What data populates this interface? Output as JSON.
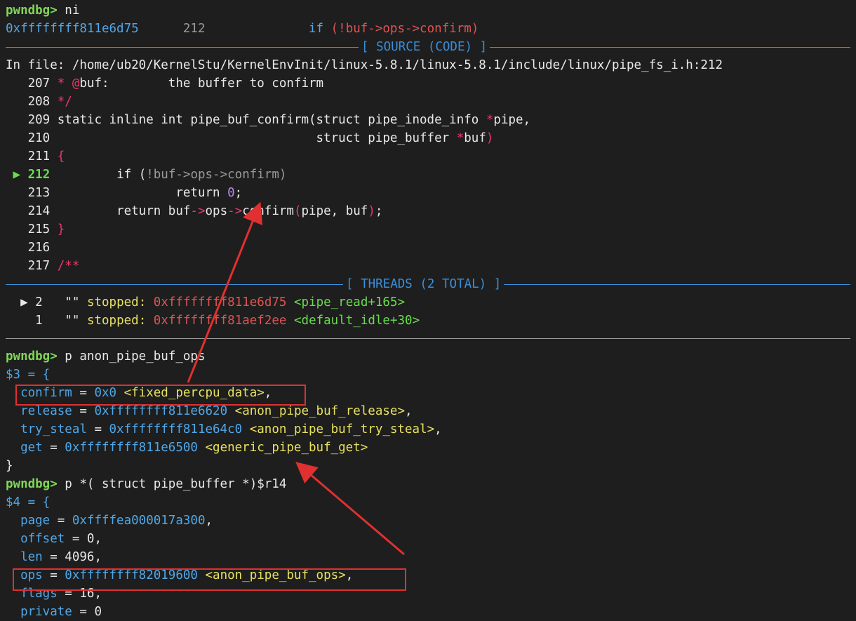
{
  "prompt": "pwndbg>",
  "cmd1": " ni",
  "pc_line": {
    "addr": "0xffffffff811e6d75",
    "lineno": "212",
    "code_if": "if",
    "code_rest": "(!buf->ops->confirm)"
  },
  "source_header": "[ SOURCE (CODE) ]",
  "in_file": "In file: /home/ub20/KernelStu/KernelEnvInit/linux-5.8.1/linux-5.8.1/include/linux/pipe_fs_i.h:212",
  "source": {
    "l207": {
      "no": "207",
      "a": " * ",
      "b": "@",
      "c": "buf:        the buffer to confirm"
    },
    "l208": {
      "no": "208",
      "a": " */"
    },
    "l209": {
      "no": "209",
      "a": "static inline int pipe_buf_confirm(struct pipe_inode_info ",
      "b": "*",
      "c": "pipe,"
    },
    "l210": {
      "no": "210",
      "a": "                                   struct pipe_buffer ",
      "b": "*",
      "c": "buf",
      "d": ")"
    },
    "l211": {
      "no": "211",
      "a": "{"
    },
    "l212": {
      "marker": "▶",
      "no": "212",
      "a": "        if (",
      "b": "!buf->ops->confirm)"
    },
    "l213": {
      "no": "213",
      "a": "                return ",
      "b": "0",
      "c": ";"
    },
    "l214": {
      "no": "214",
      "a": "        return buf",
      "b": "->",
      "c": "ops",
      "d": "->",
      "e": "confirm",
      "f": "(",
      "g": "pipe, buf",
      "h": ")",
      "i": ";"
    },
    "l215": {
      "no": "215",
      "a": "}"
    },
    "l216": {
      "no": "216"
    },
    "l217": {
      "no": "217",
      "a": "/**"
    }
  },
  "threads_header": "[ THREADS (2 TOTAL) ]",
  "threads": [
    {
      "marker": "▶",
      "id": "2",
      "name": "\"\"",
      "state": "stopped:",
      "addr": "0xffffffff811e6d75",
      "sym": "<pipe_read+165>"
    },
    {
      "marker": " ",
      "id": "1",
      "name": "\"\"",
      "state": "stopped:",
      "addr": "0xffffffff81aef2ee",
      "sym": "<default_idle+30>"
    }
  ],
  "cmd2": " p anon_pipe_buf_ops",
  "res3": {
    "head": "$3 = {",
    "rows": [
      {
        "name": "confirm",
        "val": "0x0",
        "sym": "<fixed_percpu_data>",
        "tail": ","
      },
      {
        "name": "release",
        "val": "0xffffffff811e6620",
        "sym": "<anon_pipe_buf_release>",
        "tail": ","
      },
      {
        "name": "try_steal",
        "val": "0xffffffff811e64c0",
        "sym": "<anon_pipe_buf_try_steal>",
        "tail": ","
      },
      {
        "name": "get",
        "val": "0xffffffff811e6500",
        "sym": "<generic_pipe_buf_get>",
        "tail": ""
      }
    ],
    "close": "}"
  },
  "cmd3": " p *( struct pipe_buffer *)$r14",
  "res4": {
    "head": "$4 = {",
    "page": {
      "name": "page",
      "val": "0xffffea000017a300",
      "tail": ","
    },
    "offset": {
      "name": "offset",
      "val": "0",
      "tail": ","
    },
    "len": {
      "name": "len",
      "val": "4096",
      "tail": ","
    },
    "ops": {
      "name": "ops",
      "val": "0xffffffff82019600",
      "sym": "<anon_pipe_buf_ops>",
      "tail": ","
    },
    "flags": {
      "name": "flags",
      "val": "16",
      "tail": ","
    },
    "private": {
      "name": "private",
      "val": "0"
    }
  },
  "colors": {
    "background": "#1e1e1e",
    "prompt": "#7fd657",
    "address": "#4fa7e8",
    "symbol": "#e8e060",
    "highlight_box": "#e03030"
  }
}
